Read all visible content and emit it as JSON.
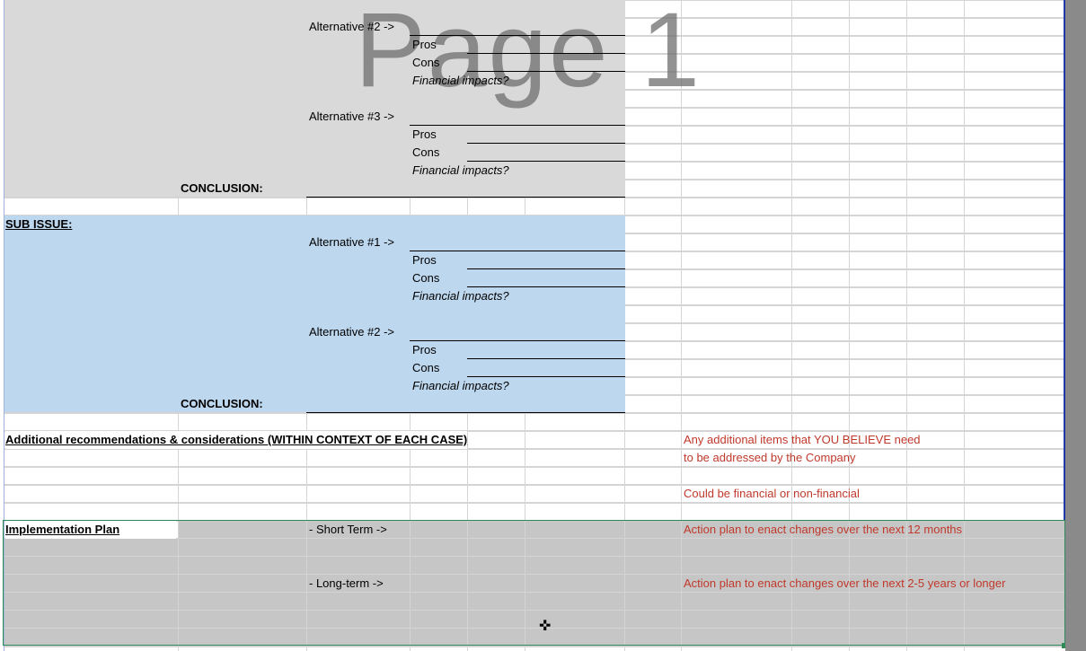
{
  "watermark": "Page 1",
  "section1": {
    "alt2_label": "Alternative #2 ->",
    "alt2_pros": "Pros",
    "alt2_cons": "Cons",
    "alt2_fin": "Financial impacts?",
    "alt3_label": "Alternative #3 ->",
    "alt3_pros": "Pros",
    "alt3_cons": "Cons",
    "alt3_fin": "Financial impacts?",
    "conclusion": "CONCLUSION:"
  },
  "section2": {
    "title": "SUB ISSUE:",
    "alt1_label": "Alternative #1 ->",
    "alt1_pros": "Pros",
    "alt1_cons": "Cons",
    "alt1_fin": "Financial impacts?",
    "alt2_label": "Alternative #2 ->",
    "alt2_pros": "Pros",
    "alt2_cons": "Cons",
    "alt2_fin": "Financial impacts?",
    "conclusion": "CONCLUSION:"
  },
  "additional": {
    "title": "Additional recommendations & considerations (WITHIN CONTEXT OF EACH CASE)",
    "note1": "Any additional items that YOU BELIEVE need",
    "note2": "to be addressed by the Company",
    "note3": "Could be financial or non-financial"
  },
  "implementation": {
    "title": "Implementation Plan",
    "short_label": "- Short Term ->",
    "short_note": "Action plan to enact changes over the next 12 months",
    "long_label": "- Long-term ->",
    "long_note": "Action plan to enact changes over the next 2-5 years or longer"
  },
  "colors": {
    "gray_fill": "#d9d9d9",
    "blue_fill": "#bdd7ee",
    "impl_fill": "#c6c6c6",
    "note_red": "#c0392b"
  }
}
